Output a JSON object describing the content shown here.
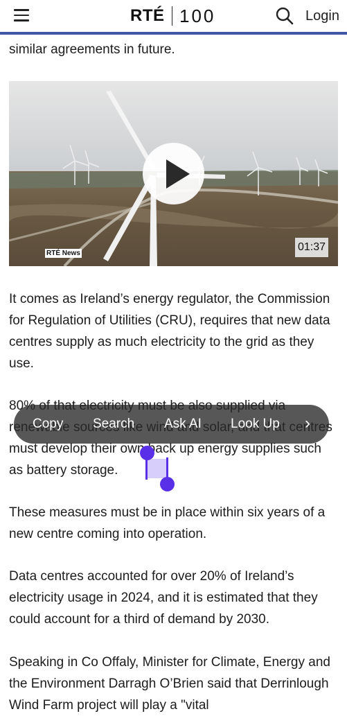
{
  "header": {
    "logo_rte": "RTÉ",
    "logo_hundred": "100",
    "login_label": "Login",
    "menu_icon": "hamburger-menu-icon",
    "search_icon": "search-icon",
    "accent_color": "#3f55a8"
  },
  "article": {
    "p0": "similar agreements in future.",
    "p1": "It comes as Ireland’s energy regulator, the Commission for Regulation of Utilities (CRU), requires that new data centres supply as much electricity to the grid as they use.",
    "p2": "80% of that electricity must be also supplied via renewable sources like wind and solar, and that centres must develop their own back up energy supplies such as battery storage.",
    "p3": "These measures must be in place within six years of a new centre coming into operation.",
    "p4": "Data centres accounted for over 20% of Ireland’s electricity usage in 2024, and it is estimated that they could account for a third of demand by 2030.",
    "p5": "Speaking in Co Offaly, Minister for Climate, Energy and the Environment Darragh O’Brien said that Derrinlough Wind Farm project will play a \"vital"
  },
  "video": {
    "badge": "RTÉ News",
    "duration": "01:37"
  },
  "selection_menu": {
    "copy": "Copy",
    "search": "Search",
    "ask_ai": "Ask AI",
    "look_up": "Look Up",
    "more": "›",
    "selected_text": "as",
    "handle_color": "#5a2fe8"
  }
}
